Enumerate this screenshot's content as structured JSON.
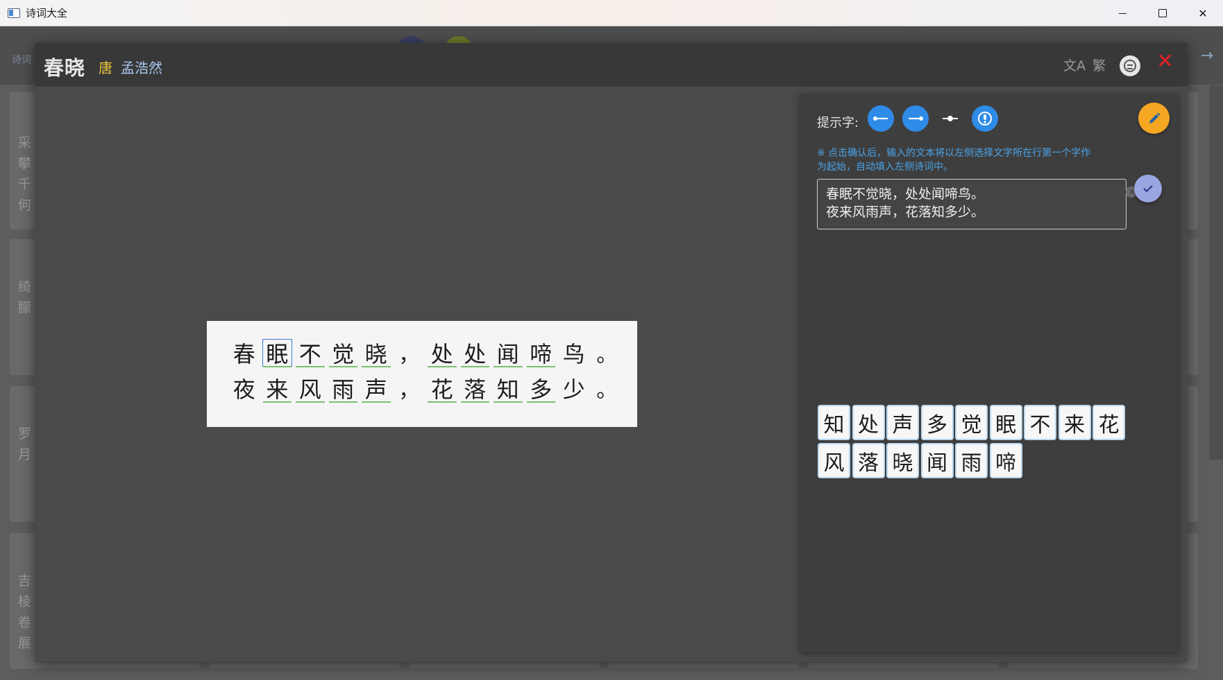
{
  "window": {
    "title": "诗词大全"
  },
  "background": {
    "tab": "诗词",
    "cards": [
      [
        "采",
        "攀",
        "千",
        "何"
      ],
      [
        "绮",
        "朦"
      ],
      [
        "罗",
        "月"
      ],
      [
        "吉",
        "棱",
        "卷",
        "展"
      ]
    ]
  },
  "poem": {
    "title": "春晓",
    "dynasty": "唐",
    "author": "孟浩然",
    "lines": [
      [
        {
          "c": "春",
          "u": false
        },
        {
          "c": "眠",
          "u": true,
          "sel": true
        },
        {
          "c": "不",
          "u": true
        },
        {
          "c": "觉",
          "u": true
        },
        {
          "c": "晓",
          "u": true
        },
        {
          "c": "，",
          "u": false
        },
        {
          "c": "处",
          "u": true
        },
        {
          "c": "处",
          "u": true
        },
        {
          "c": "闻",
          "u": true
        },
        {
          "c": "啼",
          "u": true
        },
        {
          "c": "鸟",
          "u": false
        },
        {
          "c": "。",
          "u": false
        }
      ],
      [
        {
          "c": "夜",
          "u": false
        },
        {
          "c": "来",
          "u": true
        },
        {
          "c": "风",
          "u": true
        },
        {
          "c": "雨",
          "u": true
        },
        {
          "c": "声",
          "u": true
        },
        {
          "c": "，",
          "u": false
        },
        {
          "c": "花",
          "u": true
        },
        {
          "c": "落",
          "u": true
        },
        {
          "c": "知",
          "u": true
        },
        {
          "c": "多",
          "u": true
        },
        {
          "c": "少",
          "u": false
        },
        {
          "c": "。",
          "u": false
        }
      ]
    ]
  },
  "header_icons": {
    "translate": "文A",
    "traditional": "繁"
  },
  "panel": {
    "hint_label": "提示字:",
    "note_line1": "※ 点击确认后，输入的文本将以左侧选择文字所在行第一个字作",
    "note_line2": "为起始，自动填入左侧诗词中。",
    "input_line1": "春眠不觉晓，处处闻啼鸟。",
    "input_line2": "夜来风雨声，花落知多少。",
    "tiles_row1": [
      "知",
      "处",
      "声",
      "多",
      "觉",
      "眠",
      "不",
      "来",
      "花"
    ],
    "tiles_row2": [
      "风",
      "落",
      "晓",
      "闻",
      "雨",
      "啼"
    ]
  },
  "colors": {
    "accent_blue": "#2f8be8",
    "dynasty_yellow": "#e8c440",
    "author_blue": "#a8c8f0",
    "close_red": "#e0202a",
    "edit_orange": "#f5a623",
    "confirm_lavender": "#9aa6df",
    "underline_green": "#7ac070"
  }
}
